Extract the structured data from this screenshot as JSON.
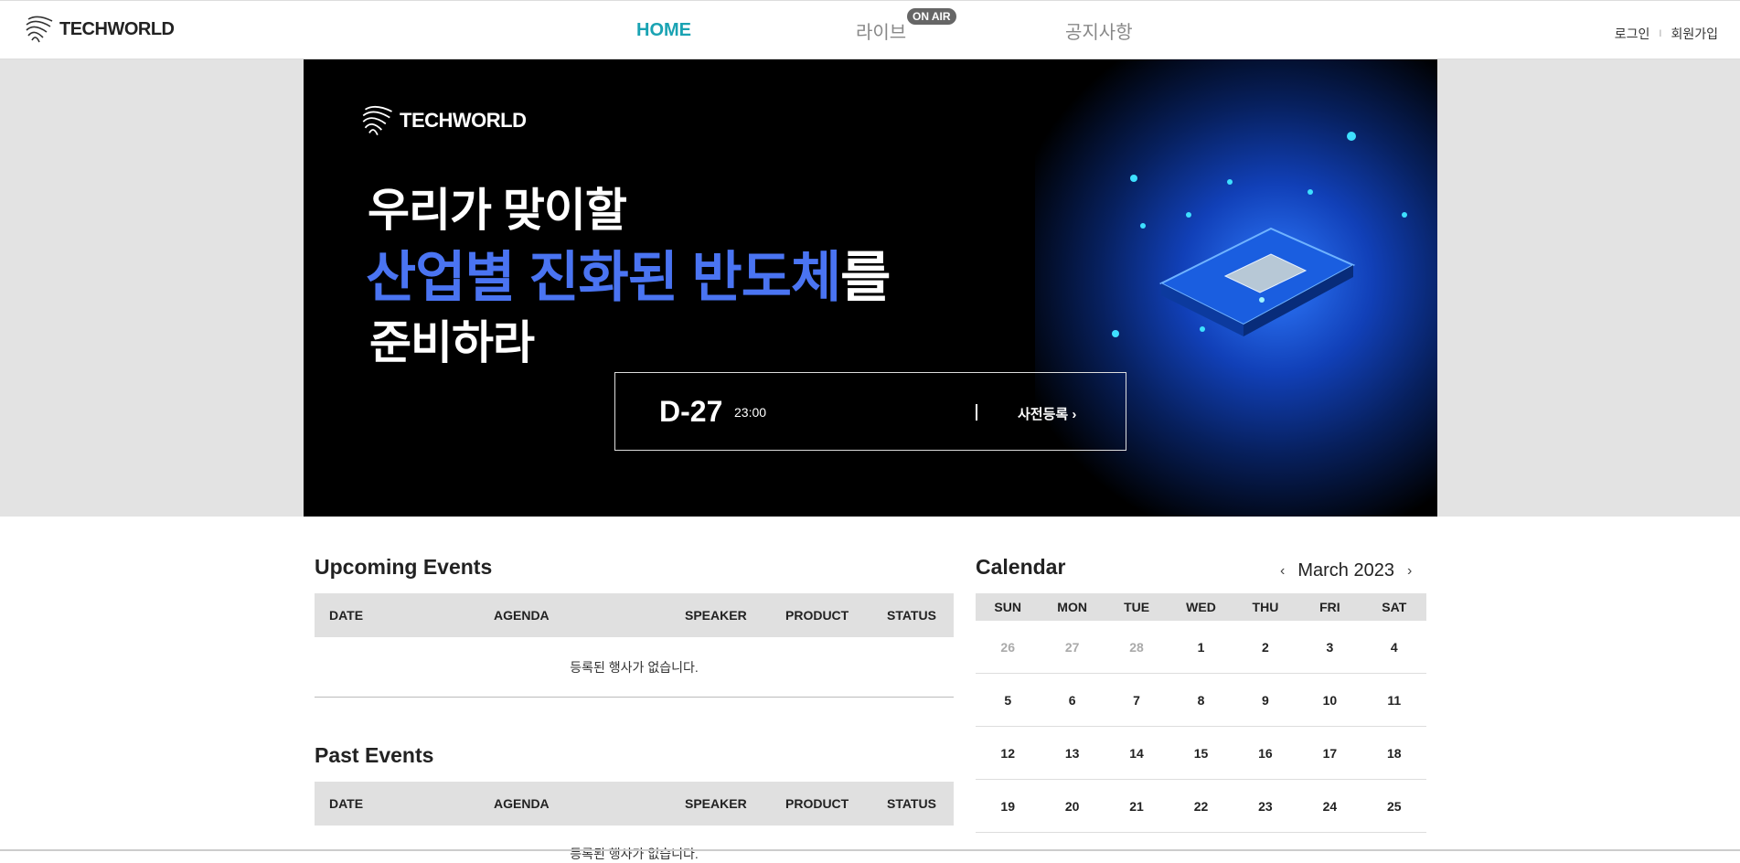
{
  "header": {
    "logo_text": "TECHWORLD",
    "nav": {
      "home": "HOME",
      "live": "라이브",
      "notice": "공지사항",
      "onair_badge": "ON AIR"
    },
    "auth": {
      "login": "로그인",
      "separator": "I",
      "signup": "회원가입"
    }
  },
  "hero": {
    "logo_text": "TECHWORLD",
    "line1": "우리가 맞이할",
    "line2_highlight": "산업별 진화된 반도체",
    "line2_rest": "를",
    "line3": "준비하라",
    "dday": "D-27",
    "time": "23:00",
    "register_label": "사전등록 ›"
  },
  "upcoming": {
    "title": "Upcoming Events",
    "columns": [
      "DATE",
      "AGENDA",
      "SPEAKER",
      "PRODUCT",
      "STATUS"
    ],
    "empty_text": "등록된 행사가 없습니다."
  },
  "past": {
    "title": "Past Events",
    "columns": [
      "DATE",
      "AGENDA",
      "SPEAKER",
      "PRODUCT",
      "STATUS"
    ],
    "empty_text": "등록된 행사가 없습니다."
  },
  "calendar": {
    "title": "Calendar",
    "month_label": "March 2023",
    "prev": "‹",
    "next": "›",
    "weekdays": [
      "SUN",
      "MON",
      "TUE",
      "WED",
      "THU",
      "FRI",
      "SAT"
    ],
    "weeks": [
      [
        "26",
        "27",
        "28",
        "1",
        "2",
        "3",
        "4"
      ],
      [
        "5",
        "6",
        "7",
        "8",
        "9",
        "10",
        "11"
      ],
      [
        "12",
        "13",
        "14",
        "15",
        "16",
        "17",
        "18"
      ],
      [
        "19",
        "20",
        "21",
        "22",
        "23",
        "24",
        "25"
      ]
    ],
    "muted_first_week": 3
  },
  "colors": {
    "accent_teal": "#1aa3b3",
    "accent_blue": "#4a74f2",
    "badge_gray": "#666666"
  }
}
